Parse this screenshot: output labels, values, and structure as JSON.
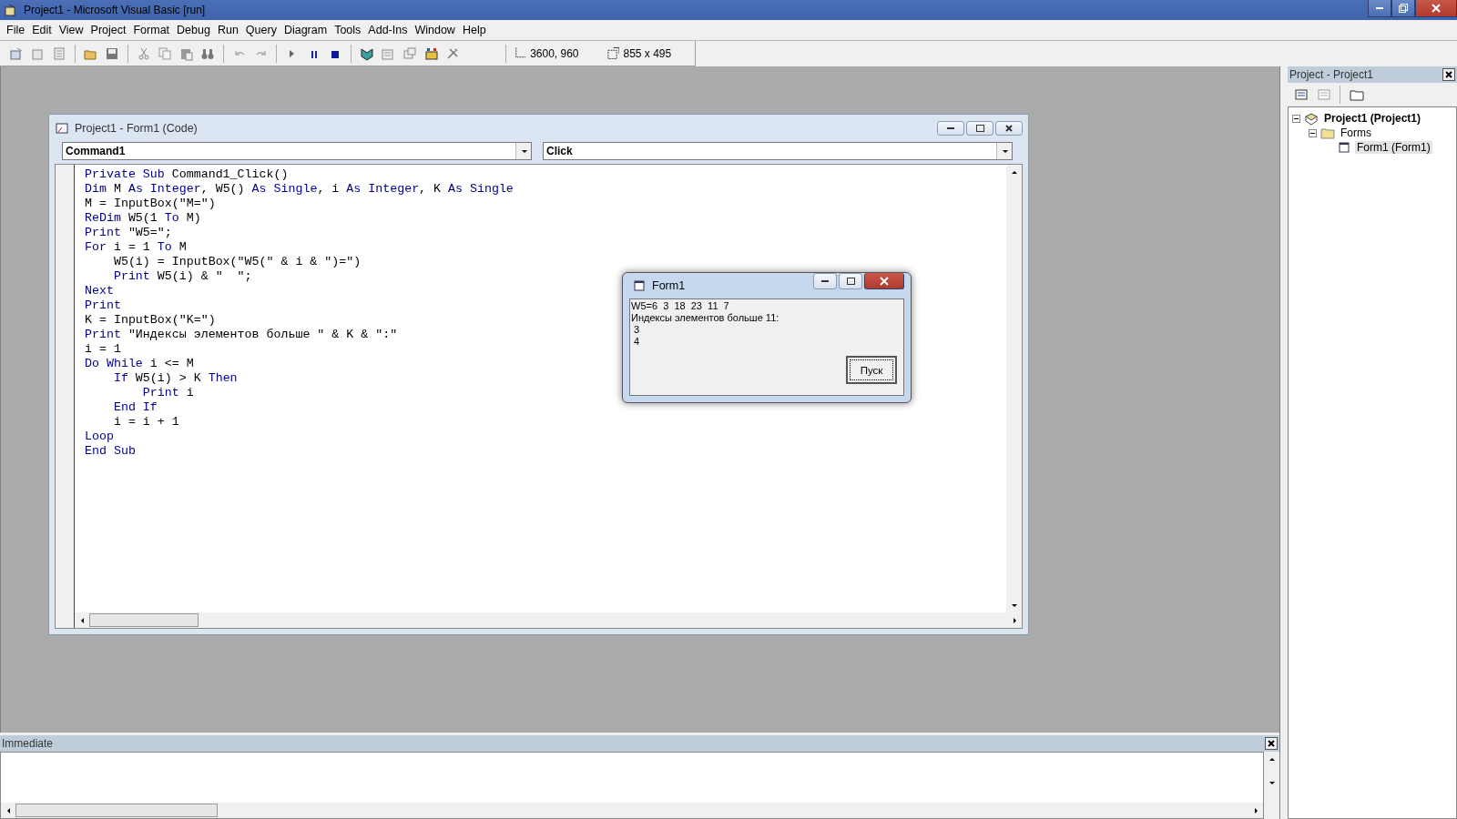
{
  "window": {
    "title": "Project1 - Microsoft Visual Basic [run]"
  },
  "menu": [
    {
      "label": "File"
    },
    {
      "label": "Edit"
    },
    {
      "label": "View"
    },
    {
      "label": "Project"
    },
    {
      "label": "Format"
    },
    {
      "label": "Debug"
    },
    {
      "label": "Run"
    },
    {
      "label": "Query"
    },
    {
      "label": "Diagram"
    },
    {
      "label": "Tools"
    },
    {
      "label": "Add-Ins"
    },
    {
      "label": "Window"
    },
    {
      "label": "Help"
    }
  ],
  "toolbar": {
    "position": "3600, 960",
    "size": "855 x 495"
  },
  "code_window": {
    "title": "Project1 - Form1 (Code)",
    "object_dropdown": "Command1",
    "procedure_dropdown": "Click",
    "lines": [
      {
        "tokens": [
          {
            "text": "Private Sub",
            "kind": "keyword"
          },
          {
            "text": " Command1_Click()",
            "kind": "plain"
          }
        ]
      },
      {
        "tokens": [
          {
            "text": "Dim",
            "kind": "keyword"
          },
          {
            "text": " M ",
            "kind": "plain"
          },
          {
            "text": "As Integer",
            "kind": "keyword"
          },
          {
            "text": ", W5() ",
            "kind": "plain"
          },
          {
            "text": "As Single",
            "kind": "keyword"
          },
          {
            "text": ", i ",
            "kind": "plain"
          },
          {
            "text": "As Integer",
            "kind": "keyword"
          },
          {
            "text": ", K ",
            "kind": "plain"
          },
          {
            "text": "As Single",
            "kind": "keyword"
          }
        ]
      },
      {
        "tokens": [
          {
            "text": "M = InputBox(\"M=\")",
            "kind": "plain"
          }
        ]
      },
      {
        "tokens": [
          {
            "text": "ReDim",
            "kind": "keyword"
          },
          {
            "text": " W5(1 ",
            "kind": "plain"
          },
          {
            "text": "To",
            "kind": "keyword"
          },
          {
            "text": " M)",
            "kind": "plain"
          }
        ]
      },
      {
        "tokens": [
          {
            "text": "Print",
            "kind": "keyword"
          },
          {
            "text": " \"W5=\";",
            "kind": "plain"
          }
        ]
      },
      {
        "tokens": [
          {
            "text": "For",
            "kind": "keyword"
          },
          {
            "text": " i = 1 ",
            "kind": "plain"
          },
          {
            "text": "To",
            "kind": "keyword"
          },
          {
            "text": " M",
            "kind": "plain"
          }
        ]
      },
      {
        "tokens": [
          {
            "text": "    W5(i) = InputBox(\"W5(\" & i & \")=\")",
            "kind": "plain"
          }
        ]
      },
      {
        "tokens": [
          {
            "text": "    Print",
            "kind": "keyword"
          },
          {
            "text": " W5(i) & \"  \";",
            "kind": "plain"
          }
        ]
      },
      {
        "tokens": [
          {
            "text": "Next",
            "kind": "keyword"
          }
        ]
      },
      {
        "tokens": [
          {
            "text": "Print",
            "kind": "keyword"
          }
        ]
      },
      {
        "tokens": [
          {
            "text": "K = InputBox(\"K=\")",
            "kind": "plain"
          }
        ]
      },
      {
        "tokens": [
          {
            "text": "Print",
            "kind": "keyword"
          },
          {
            "text": " \"Индексы элементов больше \" & K & \":\"",
            "kind": "plain"
          }
        ]
      },
      {
        "tokens": [
          {
            "text": "i = 1",
            "kind": "plain"
          }
        ]
      },
      {
        "tokens": [
          {
            "text": "Do While",
            "kind": "keyword"
          },
          {
            "text": " i <= M",
            "kind": "plain"
          }
        ]
      },
      {
        "tokens": [
          {
            "text": "    If",
            "kind": "keyword"
          },
          {
            "text": " W5(i) > K ",
            "kind": "plain"
          },
          {
            "text": "Then",
            "kind": "keyword"
          }
        ]
      },
      {
        "tokens": [
          {
            "text": "        Print",
            "kind": "keyword"
          },
          {
            "text": " i",
            "kind": "plain"
          }
        ]
      },
      {
        "tokens": [
          {
            "text": "    End If",
            "kind": "keyword"
          }
        ]
      },
      {
        "tokens": [
          {
            "text": "    i = i + 1",
            "kind": "plain"
          }
        ]
      },
      {
        "tokens": [
          {
            "text": "Loop",
            "kind": "keyword"
          }
        ]
      },
      {
        "tokens": [
          {
            "text": "End Sub",
            "kind": "keyword"
          }
        ]
      }
    ]
  },
  "form_window": {
    "title": "Form1",
    "output": [
      "W5=6  3  18  23  11  7",
      "Индексы элементов больше 11:",
      " 3",
      " 4"
    ],
    "button": "Пуск"
  },
  "project_panel": {
    "title": "Project - Project1",
    "tree": [
      {
        "label": "Project1 (Project1)",
        "selected": false,
        "expanded": true,
        "children": [
          {
            "label": "Forms",
            "selected": false,
            "expanded": true,
            "children": [
              {
                "label": "Form1 (Form1)",
                "selected": true
              }
            ]
          }
        ]
      }
    ]
  },
  "immediate": {
    "title": "Immediate"
  }
}
